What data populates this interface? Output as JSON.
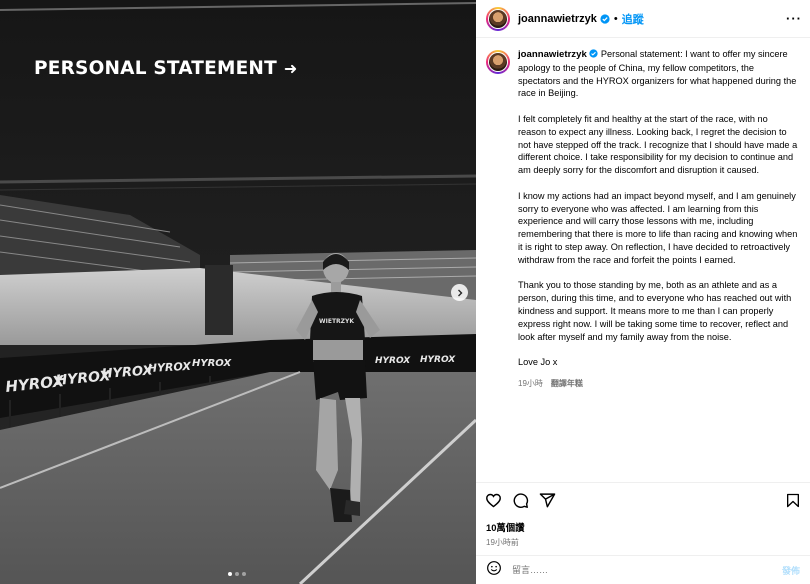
{
  "post": {
    "overlay_title": "PERSONAL STATEMENT",
    "overlay_arrow": "➜",
    "track_banner": "HYROX",
    "bib_text": "WIETRZYK",
    "carousel": {
      "count": 3,
      "active": 1
    }
  },
  "header": {
    "username": "joannawietrzyk",
    "separator": "•",
    "follow_label": "追蹤",
    "more_label": "···"
  },
  "caption": {
    "username": "joannawietrzyk",
    "paragraphs": [
      "Personal statement: I want to offer my sincere apology to the people of China, my fellow competitors, the spectators and the HYROX organizers for what happened during the race in Beijing.",
      "I felt completely fit and healthy at the start of the race, with no reason to expect any illness. Looking back, I regret the decision to not have stepped off the track. I recognize that I should have made a different choice. I take responsibility for my decision to continue and am deeply sorry for the discomfort and disruption it caused.",
      "I know my actions had an impact beyond myself, and I am genuinely sorry to everyone who was affected. I am learning from this experience and will carry those lessons with me, including remembering that there is more to life than racing and knowing when it is right to step away. On reflection, I have decided to retroactively withdraw from the race and forfeit the points I earned.",
      "Thank you to those standing by me, both as an athlete and as a person, during this time, and to everyone who has reached out with kindness and support. It means more to me than I can properly express right now. I will be taking some time to recover, reflect and look after myself and my family away from the noise.",
      "Love Jo x"
    ],
    "time_ago": "19小時",
    "translate_label": "翻譯年糕"
  },
  "actions": {
    "icons": [
      "heart-icon",
      "comment-icon",
      "share-icon",
      "bookmark-icon"
    ],
    "likes": "10萬個讚",
    "posted": "19小時前"
  },
  "comment": {
    "placeholder": "留言……",
    "post_label": "發佈"
  },
  "colors": {
    "link_blue": "#0095f6",
    "post_disabled": "#b2dffc",
    "muted": "#737373"
  }
}
